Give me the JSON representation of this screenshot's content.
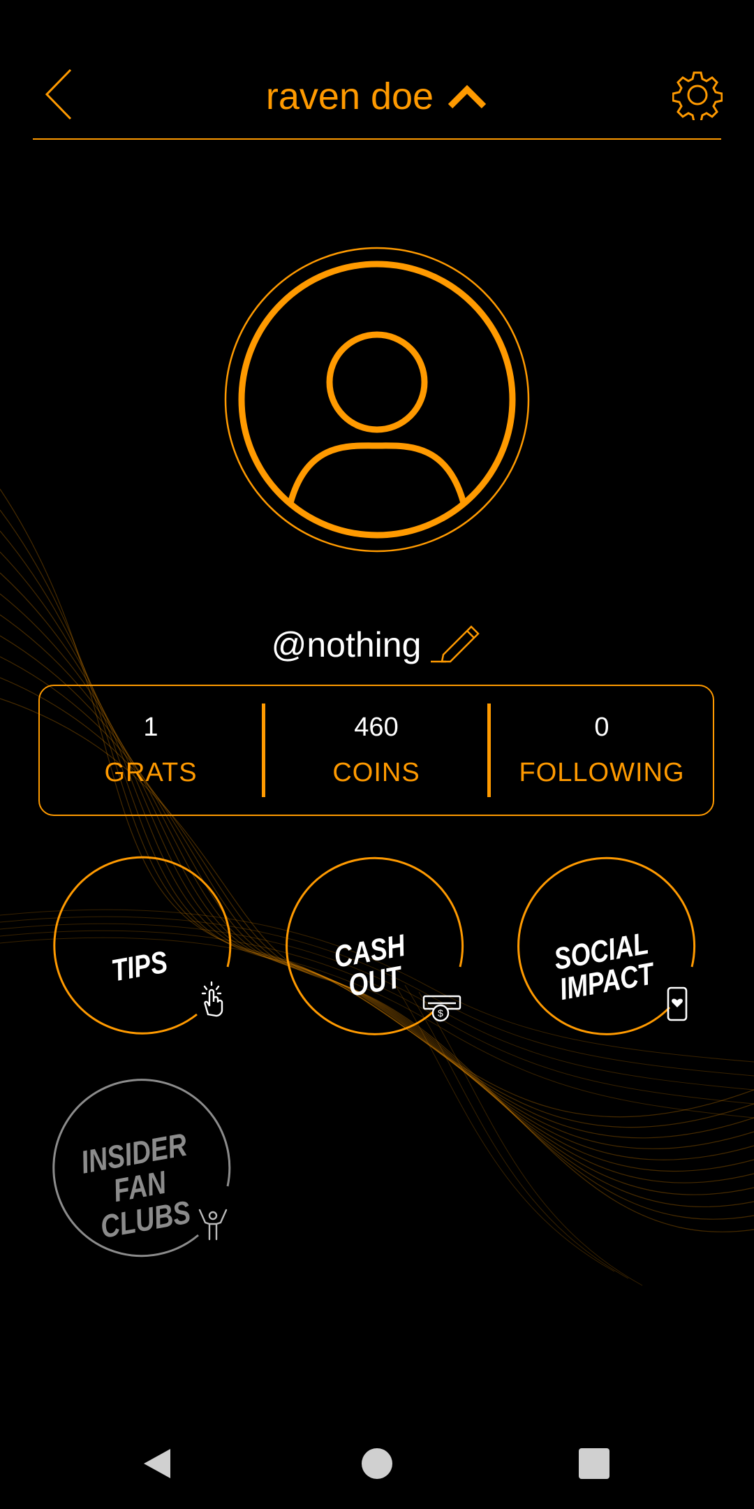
{
  "header": {
    "title": "raven doe",
    "back_icon": "chevron-left-icon",
    "expand_icon": "chevron-up-icon",
    "settings_icon": "gear-icon"
  },
  "profile": {
    "avatar_icon": "user-avatar-icon",
    "username": "@nothing",
    "edit_icon": "pencil-icon"
  },
  "stats": [
    {
      "value": "1",
      "label": "GRATS"
    },
    {
      "value": "460",
      "label": "COINS"
    },
    {
      "value": "0",
      "label": "FOLLOWING"
    }
  ],
  "actions": {
    "tips": {
      "line1": "TIPS",
      "icon": "tap-hand-icon"
    },
    "cashout": {
      "line1": "CASH",
      "line2": "OUT",
      "icon": "cash-out-icon"
    },
    "social": {
      "line1": "SOCIAL",
      "line2": "IMPACT",
      "icon": "phone-heart-icon"
    },
    "insider": {
      "line1": "INSIDER",
      "line2": "FAN CLUBS",
      "icon": "fan-cheer-icon"
    }
  },
  "colors": {
    "accent": "#FF9A00",
    "background": "#000000",
    "disabled": "#8C8C8C"
  },
  "navbar": {
    "back_icon": "nav-back-icon",
    "home_icon": "nav-home-icon",
    "recents_icon": "nav-recents-icon"
  }
}
